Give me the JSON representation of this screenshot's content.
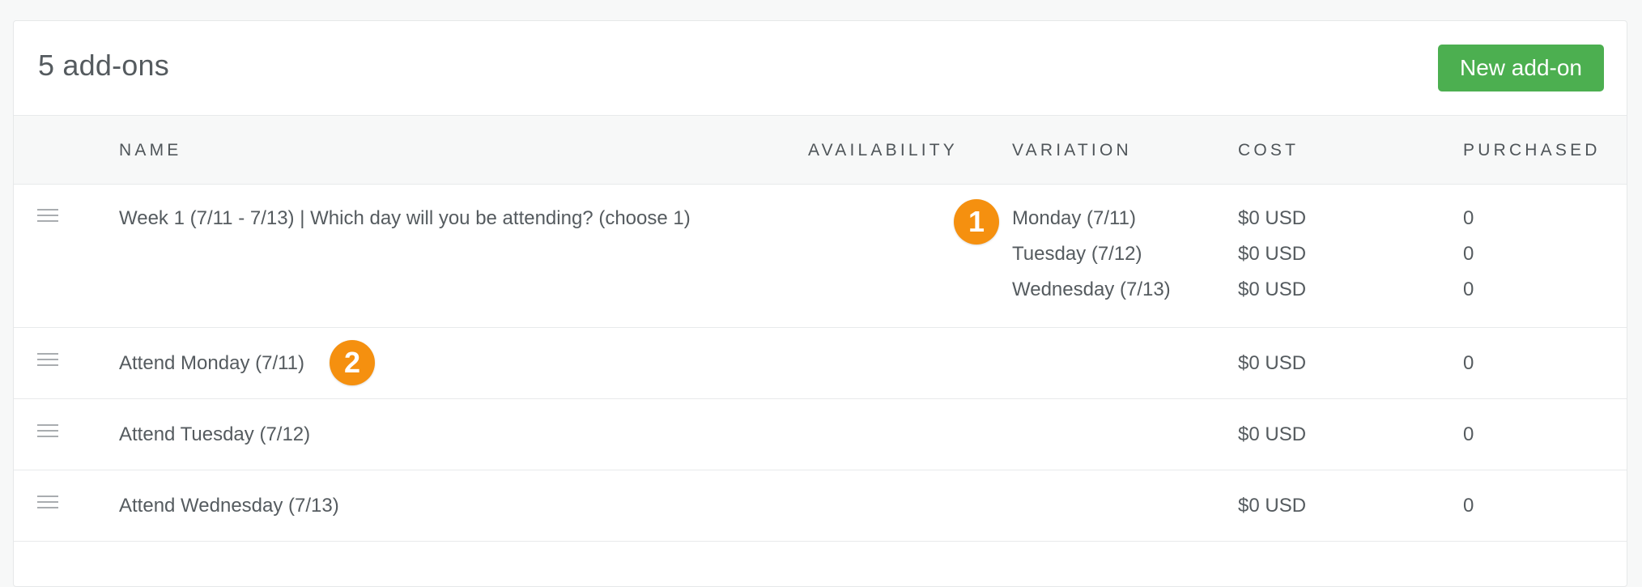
{
  "header": {
    "title": "5 add-ons",
    "new_button_label": "New add-on"
  },
  "table": {
    "columns": {
      "name": "NAME",
      "availability": "AVAILABILITY",
      "variation": "VARIATION",
      "cost": "COST",
      "purchased": "PURCHASED"
    },
    "rows": [
      {
        "name": "Week 1 (7/11 - 7/13) | Which day will you be attending? (choose 1)",
        "variations": [
          {
            "label": "Monday (7/11)",
            "cost": "$0 USD",
            "purchased": "0"
          },
          {
            "label": "Tuesday (7/12)",
            "cost": "$0 USD",
            "purchased": "0"
          },
          {
            "label": "Wednesday (7/13)",
            "cost": "$0 USD",
            "purchased": "0"
          }
        ]
      },
      {
        "name": "Attend Monday (7/11)",
        "cost": "$0 USD",
        "purchased": "0"
      },
      {
        "name": "Attend Tuesday (7/12)",
        "cost": "$0 USD",
        "purchased": "0"
      },
      {
        "name": "Attend Wednesday (7/13)",
        "cost": "$0 USD",
        "purchased": "0"
      }
    ]
  },
  "annotations": {
    "badge_1": "1",
    "badge_2": "2"
  },
  "colors": {
    "button_green": "#4caf50",
    "badge_orange": "#f5900f"
  }
}
